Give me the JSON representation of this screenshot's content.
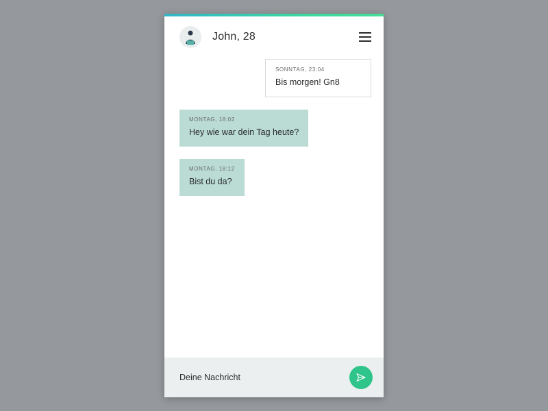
{
  "colors": {
    "accent_gradient_start": "#34b4c9",
    "accent_gradient_end": "#48dc98",
    "outgoing_bubble": "#badcd5",
    "send_button": "#2fc48a",
    "composer_bg": "#ecefef",
    "page_bg": "#95989c"
  },
  "header": {
    "contact_display": "John, 28"
  },
  "messages": [
    {
      "direction": "incoming",
      "timestamp": "SONNTAG, 23:04",
      "text": "Bis morgen! Gn8"
    },
    {
      "direction": "outgoing",
      "timestamp": "MONTAG, 18:02",
      "text": "Hey wie war dein Tag heute?"
    },
    {
      "direction": "outgoing",
      "timestamp": "MONTAG, 18:12",
      "text": "Bist du da?"
    }
  ],
  "composer": {
    "placeholder": "Deine Nachricht"
  }
}
